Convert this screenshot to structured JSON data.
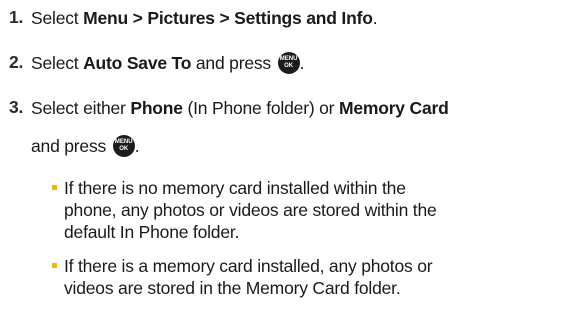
{
  "steps": [
    {
      "number": "1.",
      "lines": [
        {
          "pre": "Select ",
          "bold": "Menu > Pictures > Settings and Info",
          "post": "."
        }
      ]
    },
    {
      "number": "2.",
      "lines": [
        {
          "pre": "Select ",
          "bold": "Auto Save To",
          "post": " and press"
        }
      ]
    },
    {
      "number": "3.",
      "lines": [
        {
          "pre": "Select either ",
          "bold": "Phone",
          "mid": " (In Phone folder) or ",
          "bold2": "Memory Card"
        },
        {
          "pre": "and press"
        }
      ]
    }
  ],
  "menu_key": {
    "top": "MENU",
    "bottom": "OK",
    "icon": "menu-ok-key-icon"
  },
  "period": ".",
  "bullets": [
    {
      "lines": [
        "If there is no memory card installed within the",
        "phone, any photos or videos are stored within the",
        "default In Phone folder."
      ]
    },
    {
      "lines": [
        "If there is a memory card installed, any photos or",
        "videos are stored in the Memory Card folder."
      ]
    }
  ],
  "colors": {
    "bullet": "#f2b800",
    "text": "#1a1a1a",
    "key_bg": "#1c1c1c"
  }
}
